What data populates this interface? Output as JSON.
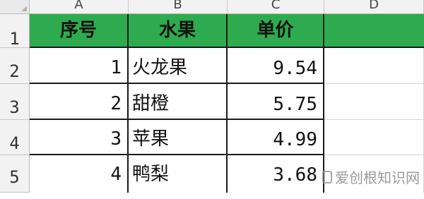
{
  "columns": [
    "A",
    "B",
    "C",
    "D"
  ],
  "rows": [
    "1",
    "2",
    "3",
    "4",
    "5"
  ],
  "header": {
    "seq": "序号",
    "fruit": "水果",
    "price": "单价"
  },
  "data": [
    {
      "seq": "1",
      "fruit": "火龙果",
      "price": "9.54"
    },
    {
      "seq": "2",
      "fruit": "甜橙",
      "price": "5.75"
    },
    {
      "seq": "3",
      "fruit": "苹果",
      "price": "4.99"
    },
    {
      "seq": "4",
      "fruit": "鸭梨",
      "price": "3.68"
    }
  ],
  "watermark": "爱创根知识网",
  "colors": {
    "header_fill": "#2eab4f",
    "grid_border": "#1a1a1a"
  }
}
